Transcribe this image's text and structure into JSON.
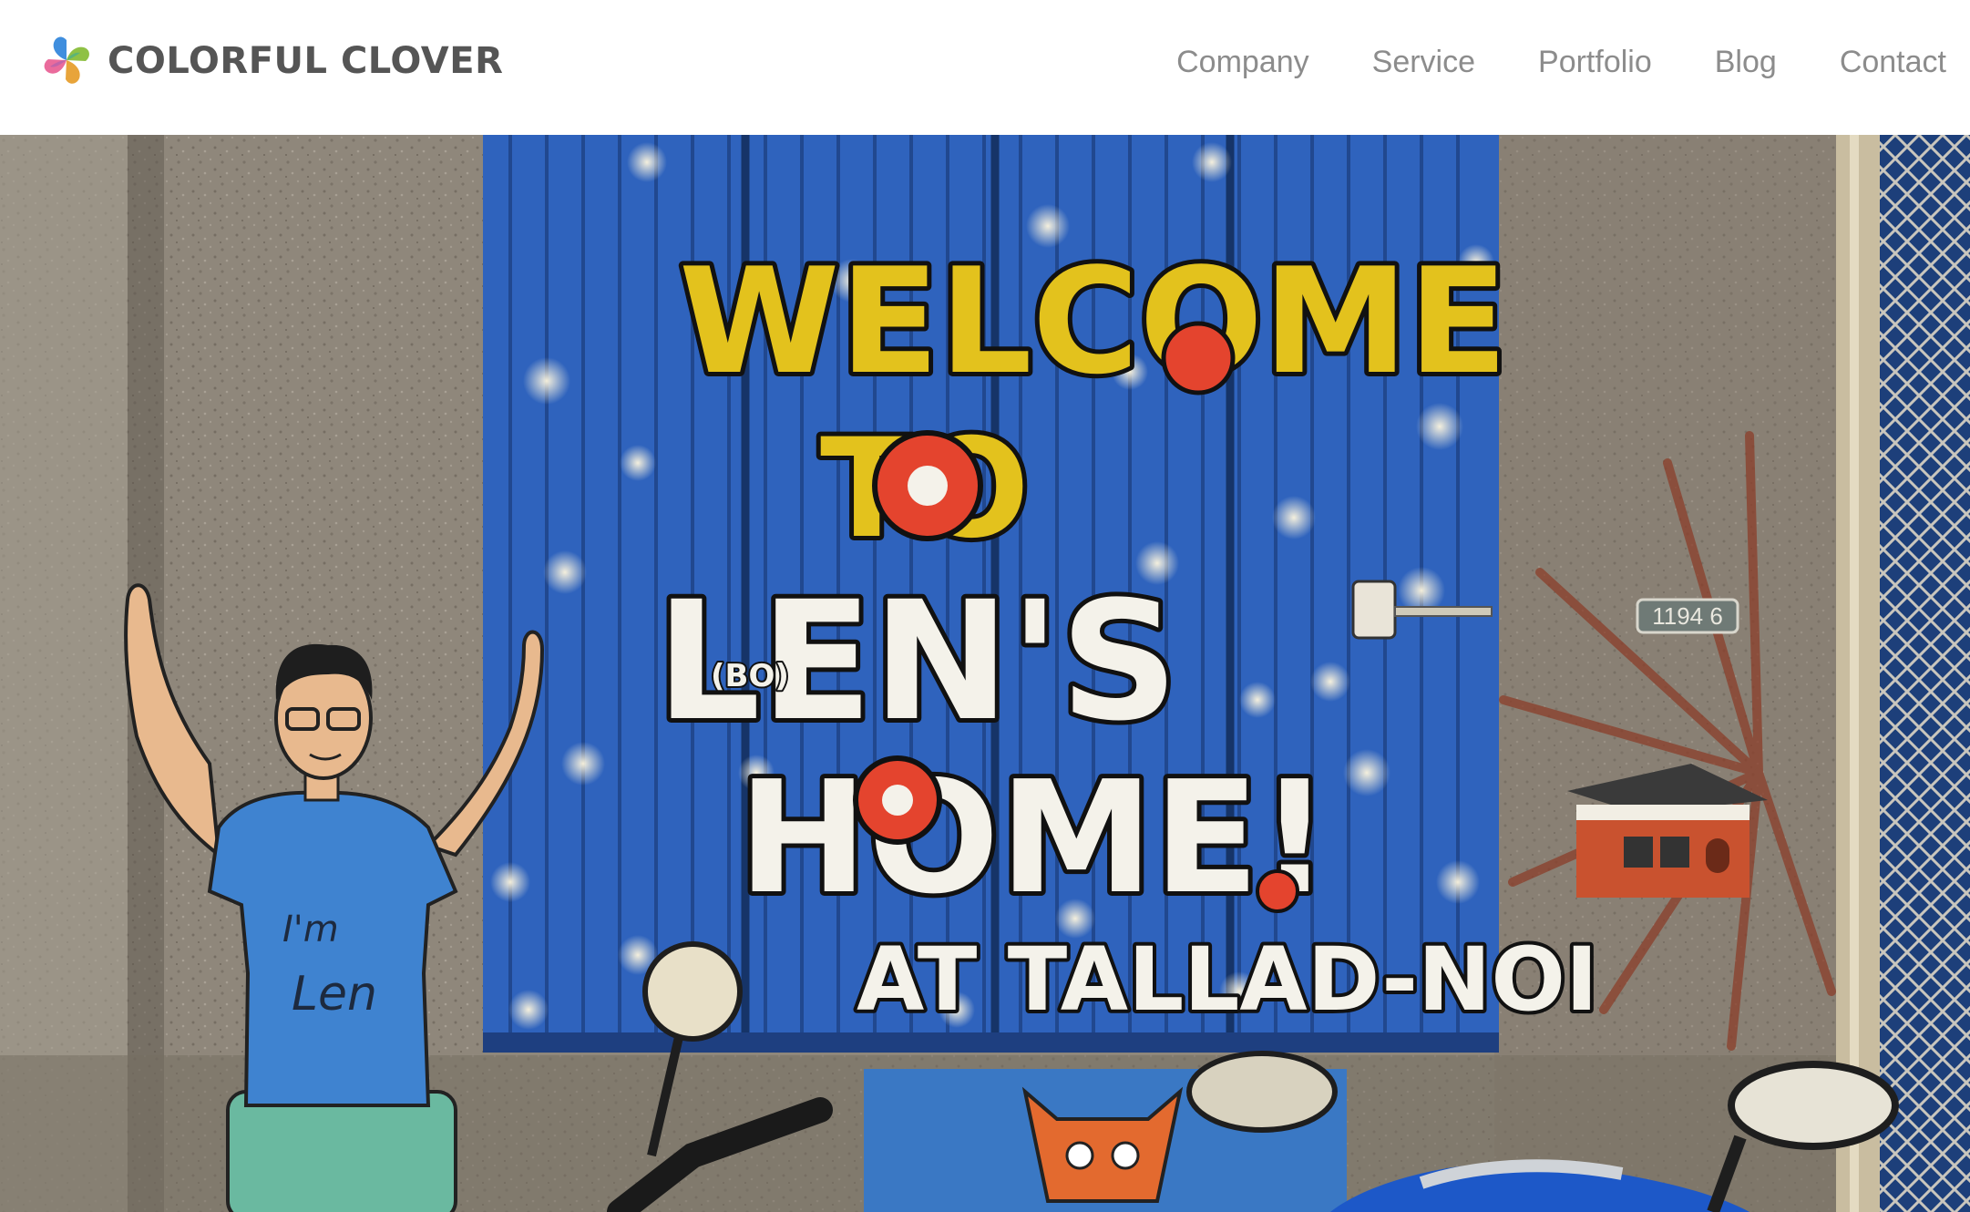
{
  "header": {
    "brand_name": "COLORFUL CLOVER",
    "nav": [
      {
        "label": "Company"
      },
      {
        "label": "Service"
      },
      {
        "label": "Portfolio"
      },
      {
        "label": "Blog"
      },
      {
        "label": "Contact"
      }
    ]
  },
  "hero": {
    "mural_lines": [
      "WELCOME",
      "TO",
      "LEN'S",
      "HOME!",
      "AT TALLAD-NOI"
    ],
    "mural_small": "(BO)",
    "shirt_text": [
      "I'm",
      "Len"
    ],
    "house_number": "1194 6"
  },
  "icons": {
    "logo": "clover-logo-icon"
  },
  "colors": {
    "nav_text": "#8c8c8c",
    "brand_text": "#555555",
    "shutter_blue": "#2f63bd",
    "wall": "#8f877b"
  }
}
